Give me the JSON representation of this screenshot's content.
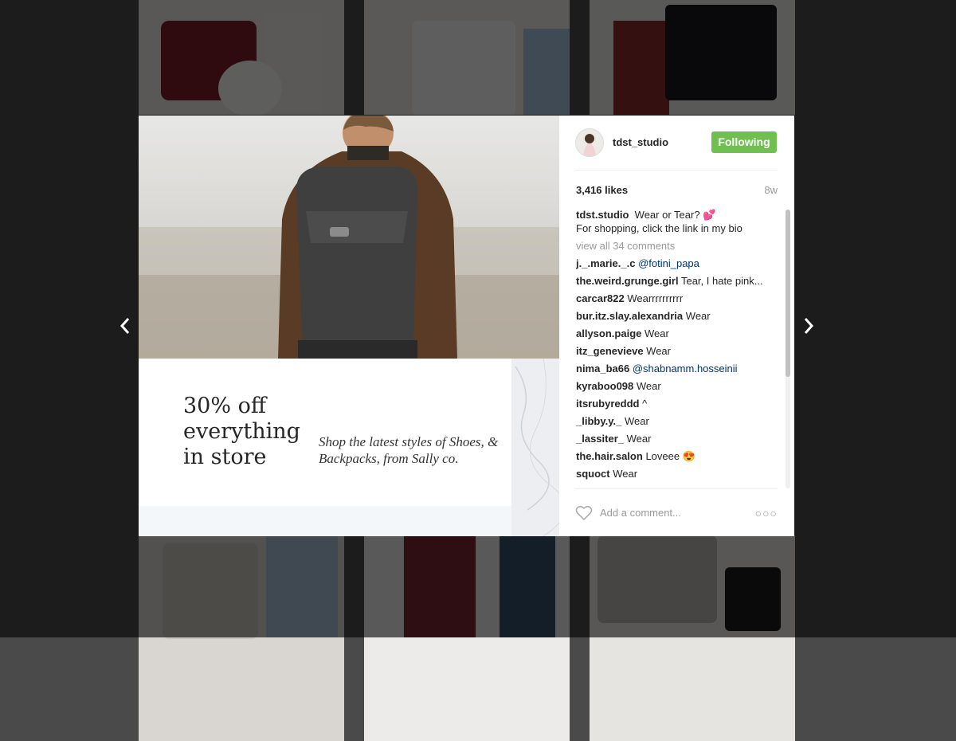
{
  "post": {
    "username": "tdst_studio",
    "follow_label": "Following",
    "likes": "3,416 likes",
    "age": "8w",
    "caption_user": "tdst.studio",
    "caption_text": "Wear or Tear? 💕",
    "caption_line2": "For shopping, click the link in my bio",
    "view_all": "view all 34 comments",
    "comments": [
      {
        "user": "j._.marie._.c",
        "text": "@fotini_papa",
        "mention": true
      },
      {
        "user": "the.weird.grunge.girl",
        "text": "Tear, I hate pink...",
        "mention": false
      },
      {
        "user": "carcar822",
        "text": "Wearrrrrrrrrr",
        "mention": false
      },
      {
        "user": "bur.itz.slay.alexandria",
        "text": "Wear",
        "mention": false
      },
      {
        "user": "allyson.paige",
        "text": "Wear",
        "mention": false
      },
      {
        "user": "itz_genevieve",
        "text": "Wear",
        "mention": false
      },
      {
        "user": "nima_ba66",
        "text": "@shabnamm.hosseinii",
        "mention": true
      },
      {
        "user": "kyraboo098",
        "text": "Wear",
        "mention": false
      },
      {
        "user": "itsrubyreddd",
        "text": "^",
        "mention": false
      },
      {
        "user": "_libby.y._",
        "text": "Wear",
        "mention": false
      },
      {
        "user": "_lassiter_",
        "text": "Wear",
        "mention": false
      },
      {
        "user": "the.hair.salon",
        "text": "Loveee 😍",
        "mention": false
      },
      {
        "user": "squoct",
        "text": "Wear",
        "mention": false
      }
    ],
    "add_comment_placeholder": "Add a comment...",
    "more_label": "○○○"
  },
  "promo": {
    "headline": "30% off everything in store",
    "subtext": "Shop the latest styles of Shoes, & Backpacks, from Sally co."
  },
  "colors": {
    "follow": "#70c050",
    "mention": "#003569",
    "muted": "#999999"
  },
  "icons": {
    "prev": "chevron-left-icon",
    "next": "chevron-right-icon",
    "like": "heart-icon",
    "more": "more-options-icon"
  }
}
